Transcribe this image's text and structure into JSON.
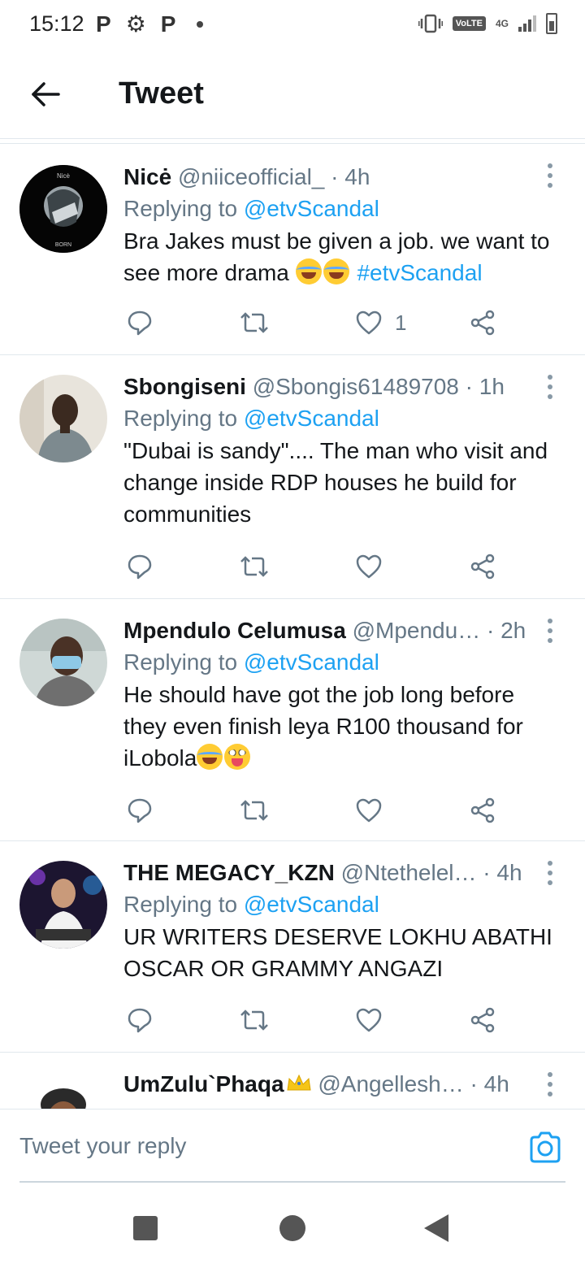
{
  "status_bar": {
    "time": "15:12",
    "left_icons": [
      "p-notification-icon",
      "gear-icon",
      "p-notification-icon",
      "dot-icon"
    ],
    "p_glyph": "P",
    "volte": "VoLTE",
    "network": "4G",
    "right_icons": [
      "vibrate-icon",
      "volte-icon",
      "network-4g-icon",
      "signal-icon",
      "battery-icon"
    ]
  },
  "header": {
    "title": "Tweet",
    "back_icon": "arrow-left-icon"
  },
  "tweets": [
    {
      "name": "Nicė",
      "handle": "@niiceofficial_",
      "sep": "·",
      "time": "4h",
      "replying_prefix": "Replying to",
      "replying_to": "@etvScandal",
      "text": "Bra Jakes must be given a job. we want to see more drama",
      "emojis": [
        "laughing-tears-emoji",
        "laughing-tears-emoji"
      ],
      "hashtag": "#etvScandal",
      "likes": "1"
    },
    {
      "name": "Sbongiseni",
      "handle": "@Sbongis61489708",
      "sep": "·",
      "time": "1h",
      "replying_prefix": "Replying to",
      "replying_to": "@etvScandal",
      "text": "\"Dubai is sandy\".... The man who visit and change inside RDP houses he build for communities",
      "likes": ""
    },
    {
      "name": "Mpendulo Celumusa",
      "handle": "@Mpendu…",
      "sep": "·",
      "time": "2h",
      "replying_prefix": "Replying to",
      "replying_to": "@etvScandal",
      "text": "He should have got the job long before they even finish leya R100 thousand for iLobola",
      "emojis": [
        "laughing-tears-emoji",
        "zany-face-emoji"
      ],
      "likes": ""
    },
    {
      "name": "THE MEGACY_KZN",
      "handle": "@Ntethelel…",
      "sep": "·",
      "time": "4h",
      "replying_prefix": "Replying to",
      "replying_to": "@etvScandal",
      "text": "UR WRITERS DESERVE LOKHU ABATHI OSCAR OR GRAMMY ANGAZI",
      "likes": ""
    },
    {
      "name": "UmZulu`Phaqa",
      "handle": "@Angellesh…",
      "sep": "·",
      "time": "4h",
      "name_emoji": "crown-emoji"
    }
  ],
  "action_icons": [
    "reply-icon",
    "retweet-icon",
    "like-icon",
    "share-icon"
  ],
  "reply_bar": {
    "placeholder": "Tweet your reply",
    "camera_icon": "camera-icon"
  },
  "nav_bar": {
    "icons": [
      "recent-apps-icon",
      "home-icon",
      "back-icon"
    ]
  },
  "colors": {
    "link_blue": "#1da1f2",
    "secondary_text": "#657786",
    "primary_text": "#14171a",
    "divider": "#e1e8ed"
  }
}
